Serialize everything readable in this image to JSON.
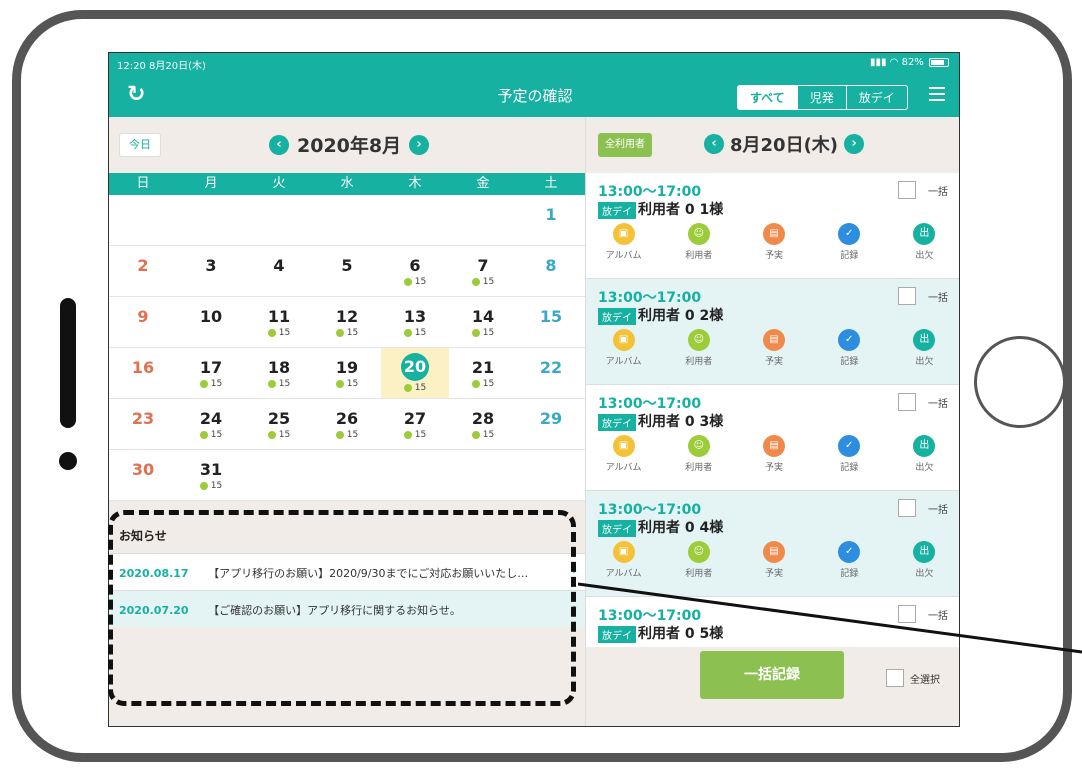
{
  "status": {
    "time": "12:20 8月20日(木)",
    "battery": "82%"
  },
  "header": {
    "title": "予定の確認",
    "filters": [
      "すべて",
      "児発",
      "放デイ"
    ]
  },
  "calendar": {
    "today_label": "今日",
    "month_title": "2020年8月",
    "weekdays": [
      "日",
      "月",
      "火",
      "水",
      "木",
      "金",
      "土"
    ],
    "weeks": [
      [
        {
          "d": ""
        },
        {
          "d": ""
        },
        {
          "d": ""
        },
        {
          "d": ""
        },
        {
          "d": ""
        },
        {
          "d": ""
        },
        {
          "d": "1"
        }
      ],
      [
        {
          "d": "2"
        },
        {
          "d": "3"
        },
        {
          "d": "4"
        },
        {
          "d": "5"
        },
        {
          "d": "6",
          "c": "15"
        },
        {
          "d": "7",
          "c": "15"
        },
        {
          "d": "8"
        }
      ],
      [
        {
          "d": "9"
        },
        {
          "d": "10"
        },
        {
          "d": "11",
          "c": "15"
        },
        {
          "d": "12",
          "c": "15"
        },
        {
          "d": "13",
          "c": "15"
        },
        {
          "d": "14",
          "c": "15"
        },
        {
          "d": "15"
        }
      ],
      [
        {
          "d": "16"
        },
        {
          "d": "17",
          "c": "15"
        },
        {
          "d": "18",
          "c": "15"
        },
        {
          "d": "19",
          "c": "15"
        },
        {
          "d": "20",
          "c": "15",
          "sel": true
        },
        {
          "d": "21",
          "c": "15"
        },
        {
          "d": "22"
        }
      ],
      [
        {
          "d": "23"
        },
        {
          "d": "24",
          "c": "15"
        },
        {
          "d": "25",
          "c": "15"
        },
        {
          "d": "26",
          "c": "15"
        },
        {
          "d": "27",
          "c": "15"
        },
        {
          "d": "28",
          "c": "15"
        },
        {
          "d": "29"
        }
      ],
      [
        {
          "d": "30"
        },
        {
          "d": "31",
          "c": "15"
        },
        {
          "d": ""
        },
        {
          "d": ""
        },
        {
          "d": ""
        },
        {
          "d": ""
        },
        {
          "d": ""
        }
      ]
    ]
  },
  "news": {
    "heading": "お知らせ",
    "items": [
      {
        "date": "2020.08.17",
        "text": "【アプリ移行のお願い】2020/9/30までにご対応お願いいたし…"
      },
      {
        "date": "2020.07.20",
        "text": "【ご確認のお願い】アプリ移行に関するお知らせ。"
      }
    ]
  },
  "schedule": {
    "all_users_label": "全利用者",
    "date_title": "8月20日(木)",
    "bulk_label": "一括",
    "tag": "放デイ",
    "icon_labels": [
      "アルバム",
      "利用者",
      "予実",
      "記録",
      "出欠"
    ],
    "entries": [
      {
        "time": "13:00〜17:00",
        "name": "利用者 0 1様"
      },
      {
        "time": "13:00〜17:00",
        "name": "利用者 0 2様"
      },
      {
        "time": "13:00〜17:00",
        "name": "利用者 0 3様"
      },
      {
        "time": "13:00〜17:00",
        "name": "利用者 0 4様"
      },
      {
        "time": "13:00〜17:00",
        "name": "利用者 0 5様"
      }
    ],
    "bulk_record_button": "一括記録",
    "select_all_label": "全選択"
  },
  "colors": {
    "primary": "#16b1a0",
    "accent_green": "#8cc152",
    "sunday": "#e07050",
    "saturday": "#3aa9c6"
  }
}
